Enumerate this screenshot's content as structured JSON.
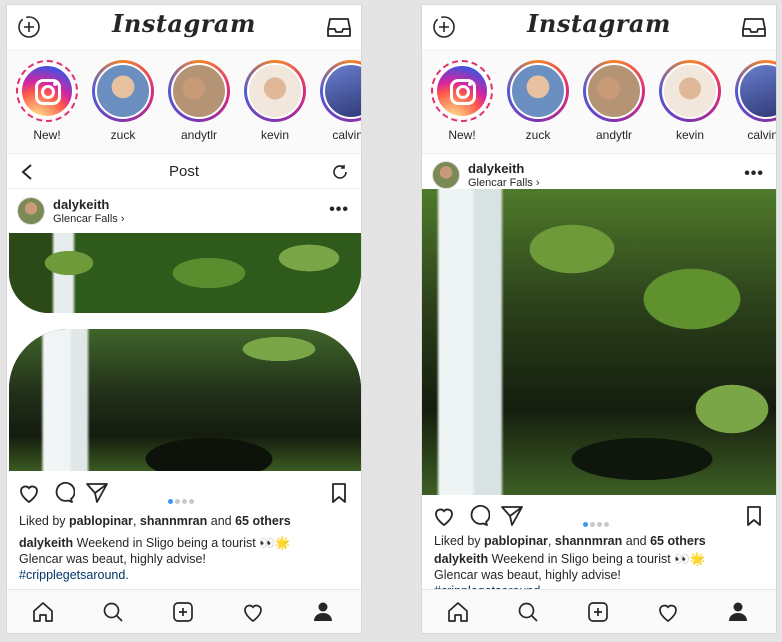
{
  "app": {
    "logo": "Instagram"
  },
  "stories": [
    {
      "name": "New!",
      "kind": "ig-logo"
    },
    {
      "name": "zuck",
      "kind": "photo",
      "color": "#6a8fc0"
    },
    {
      "name": "andytlr",
      "kind": "photo",
      "color": "#b49474"
    },
    {
      "name": "kevin",
      "kind": "photo",
      "color": "#8e6a52"
    },
    {
      "name": "calvinh",
      "kind": "photo",
      "color": "#3c4a8a"
    }
  ],
  "post_header": {
    "title": "Post"
  },
  "post": {
    "username": "dalykeith",
    "location": "Glencar Falls ›",
    "more_label": "•••",
    "likes_prefix": "Liked by ",
    "liker1": "pablopinar",
    "sep": ", ",
    "liker2": "shannmran",
    "and_text": " and ",
    "others": "65 others",
    "caption_user": "dalykeith",
    "caption_text": " Weekend in Sligo being a tourist 👀🌟",
    "caption_line2": "Glencar was beaut, highly advise!",
    "hashtag": "#cripplegetsaround."
  },
  "colors": {
    "accent": "#3897f0",
    "hashtag": "#003569",
    "foliage": "#3d6b22",
    "water": "#e8eef0"
  }
}
